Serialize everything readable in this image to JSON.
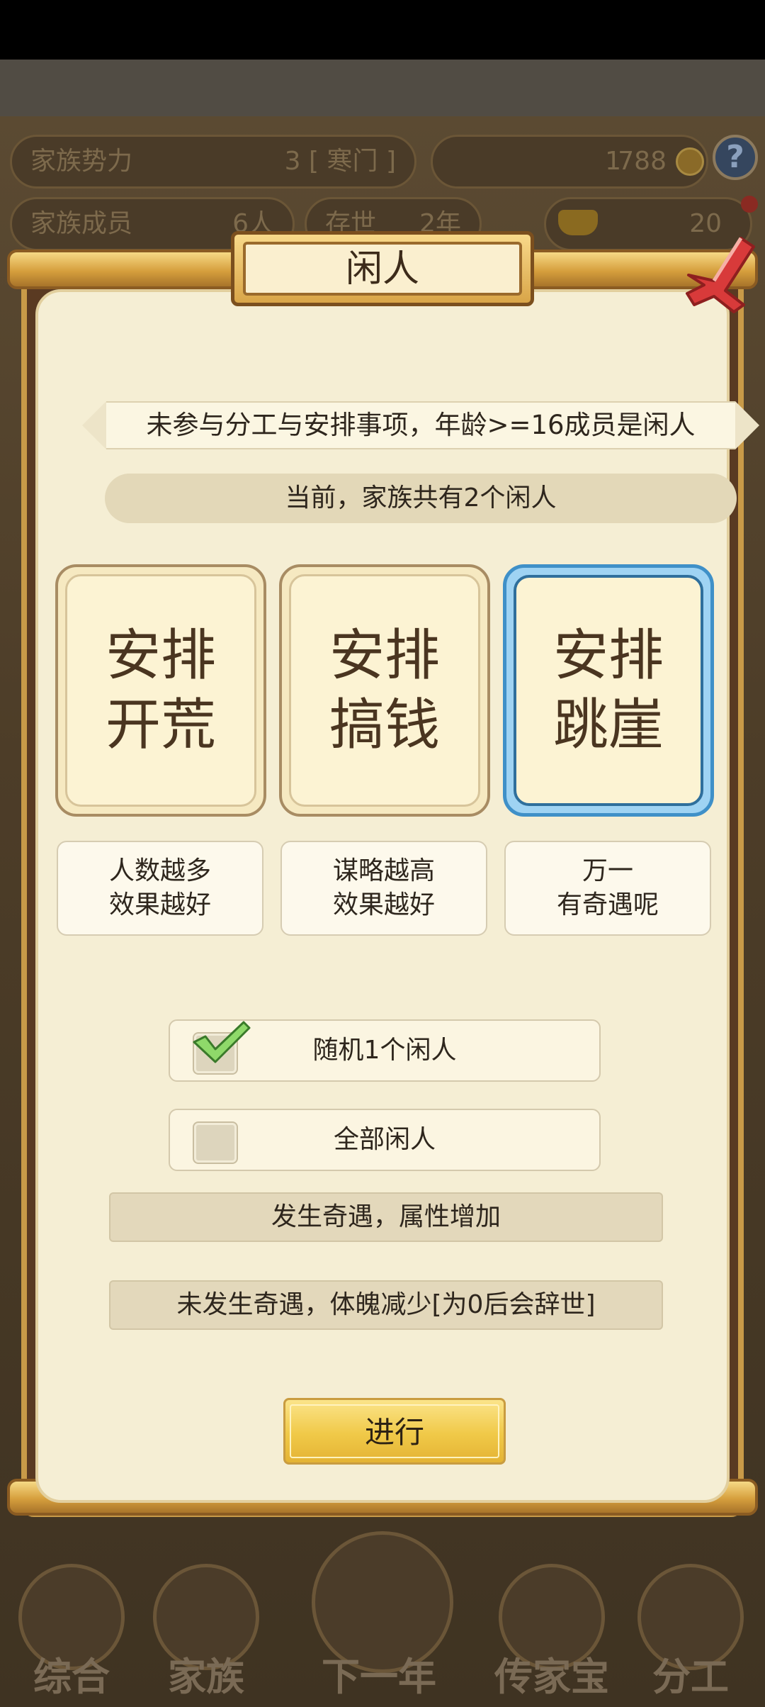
{
  "background": {
    "stats": {
      "power_label": "家族势力",
      "power_value": "3 [ 寒门 ]",
      "currency_value": "1",
      "currency2_value": "788",
      "members_label": "家族成员",
      "members_value": "6人",
      "years_label": "存世",
      "years_value": "2年",
      "gold_value": "20"
    },
    "help_icon": "?",
    "nav": [
      {
        "label": "综合",
        "icon": "scroll-icon"
      },
      {
        "label": "家族",
        "icon": "house-icon"
      },
      {
        "label": "下一年",
        "icon": "mountain-icon"
      },
      {
        "label": "传家宝",
        "icon": "treasure-icon"
      },
      {
        "label": "分工",
        "icon": "people-icon"
      }
    ]
  },
  "dialog": {
    "title": "闲人",
    "info": "未参与分工与安排事项，年龄>=16成员是闲人",
    "count_text": "当前，家族共有2个闲人",
    "options": [
      {
        "line1": "安排",
        "line2": "开荒",
        "desc1": "人数越多",
        "desc2": "效果越好",
        "selected": false
      },
      {
        "line1": "安排",
        "line2": "搞钱",
        "desc1": "谋略越高",
        "desc2": "效果越好",
        "selected": false
      },
      {
        "line1": "安排",
        "line2": "跳崖",
        "desc1": "万一",
        "desc2": "有奇遇呢",
        "selected": true
      }
    ],
    "choices": [
      {
        "label": "随机1个闲人",
        "checked": true
      },
      {
        "label": "全部闲人",
        "checked": false
      }
    ],
    "results": [
      "发生奇遇，属性增加",
      "未发生奇遇，体魄减少[为0后会辞世]"
    ],
    "go_label": "进行",
    "colors": {
      "panel": "#f5eed4",
      "gold": "#d9a548",
      "selected_border": "#3f90c8",
      "close": "#d83a3a"
    }
  }
}
